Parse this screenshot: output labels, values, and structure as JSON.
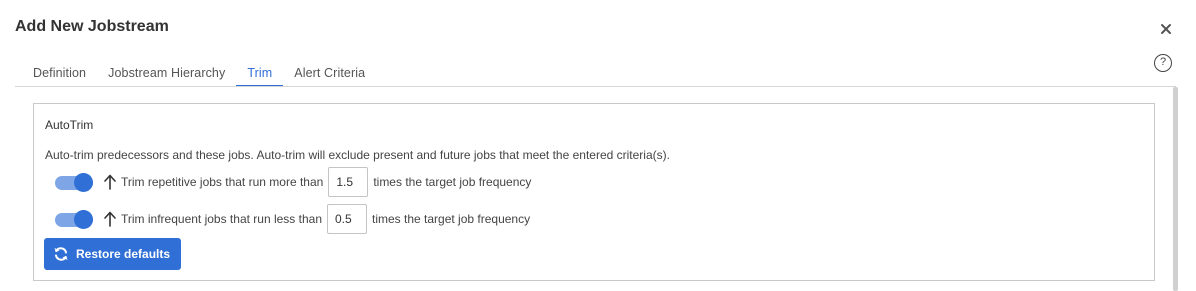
{
  "dialog": {
    "title": "Add New Jobstream",
    "close_icon": "close-icon",
    "help_label": "?"
  },
  "tabs": [
    {
      "label": "Definition",
      "active": false
    },
    {
      "label": "Jobstream Hierarchy",
      "active": false
    },
    {
      "label": "Trim",
      "active": true
    },
    {
      "label": "Alert Criteria",
      "active": false
    }
  ],
  "autotrim": {
    "heading": "AutoTrim",
    "description": "Auto-trim predecessors and these jobs. Auto-trim will exclude present and future jobs that meet the entered criteria(s).",
    "rules": [
      {
        "enabled": true,
        "icon": "arrow-up-icon",
        "label": "Trim repetitive jobs that run more than",
        "value": "1.5",
        "suffix": "times the target job frequency"
      },
      {
        "enabled": true,
        "icon": "arrow-up-icon",
        "label": "Trim infrequent jobs that run less than",
        "value": "0.5",
        "suffix": "times the target job frequency"
      }
    ],
    "restore_label": "Restore defaults",
    "restore_icon": "refresh-icon"
  },
  "colors": {
    "accent": "#2f6fd6",
    "toggle_track": "#7ea6e6"
  }
}
